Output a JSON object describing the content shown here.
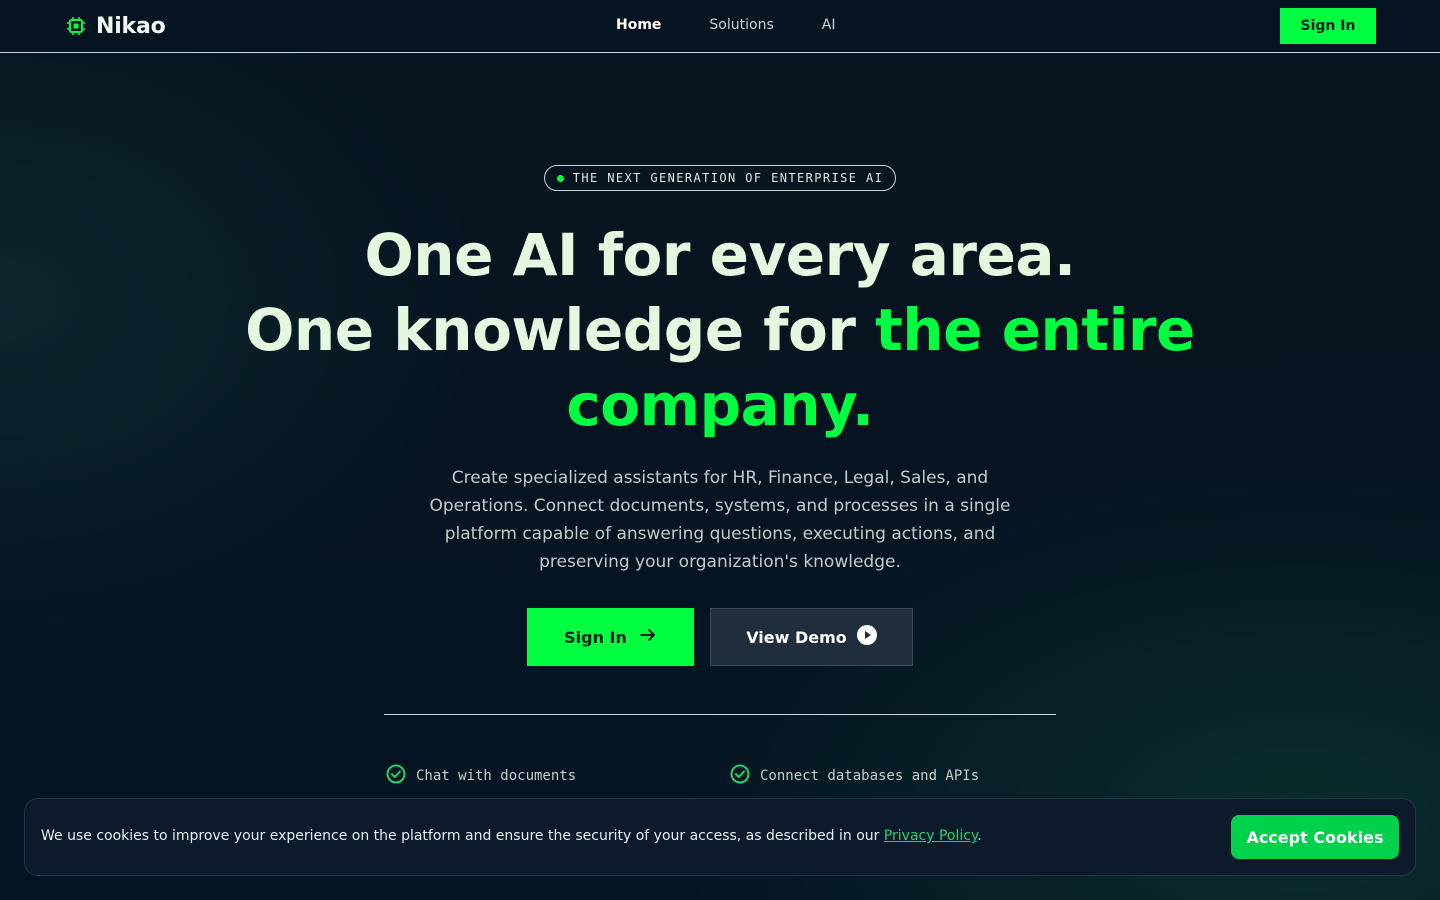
{
  "brand": {
    "name": "Nikao",
    "icon": "chip-icon",
    "accent_color": "#00ff41"
  },
  "nav": {
    "items": [
      {
        "label": "Home",
        "active": true
      },
      {
        "label": "Solutions",
        "active": false
      },
      {
        "label": "AI",
        "active": false
      }
    ],
    "signin_label": "Sign In"
  },
  "hero": {
    "badge": "THE NEXT GENERATION OF ENTERPRISE AI",
    "headline_line1": "One AI for every area.",
    "headline_line2_plain": "One knowledge for ",
    "headline_line2_accent": "the entire company.",
    "description": "Create specialized assistants for HR, Finance, Legal, Sales, and Operations. Connect documents, systems, and processes in a single platform capable of answering questions, executing actions, and preserving your organization's knowledge.",
    "cta_primary": "Sign In",
    "cta_secondary": "View Demo",
    "features": [
      {
        "label": "Chat with documents",
        "icon": "check-circle-icon"
      },
      {
        "label": "Connect databases and APIs",
        "icon": "check-circle-icon"
      }
    ]
  },
  "cookie_banner": {
    "text_before": "We use cookies to improve your experience on the platform and ensure the security of your access, as described in our ",
    "link_label": "Privacy Policy",
    "text_after": ".",
    "accept_label": "Accept Cookies"
  },
  "colors": {
    "background": "#06141f",
    "accent": "#00ff41",
    "headline": "#e4f7df",
    "cookie_button": "#00d14a"
  }
}
